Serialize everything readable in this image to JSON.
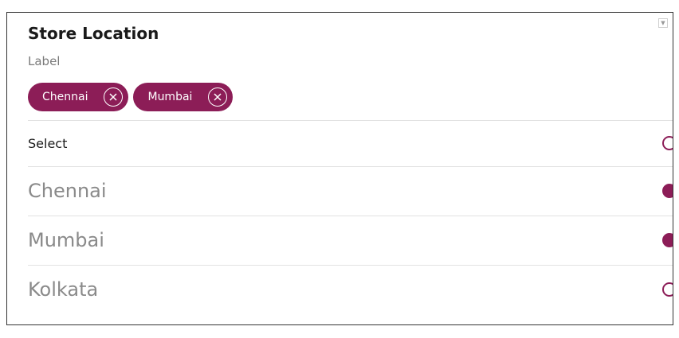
{
  "panel": {
    "title": "Store Location",
    "label": "Label",
    "scroll_glyph": "▼"
  },
  "chips": [
    {
      "label": "Chennai",
      "remove_icon": "close-circle-icon"
    },
    {
      "label": "Mumbai",
      "remove_icon": "close-circle-icon"
    }
  ],
  "select_all": {
    "label": "Select",
    "checked": false
  },
  "options": [
    {
      "label": "Chennai",
      "checked": true
    },
    {
      "label": "Mumbai",
      "checked": true
    },
    {
      "label": "Kolkata",
      "checked": false
    }
  ],
  "colors": {
    "accent": "#8c1d57",
    "option_text": "#8a8a8a",
    "divider": "#e2e2e2"
  }
}
